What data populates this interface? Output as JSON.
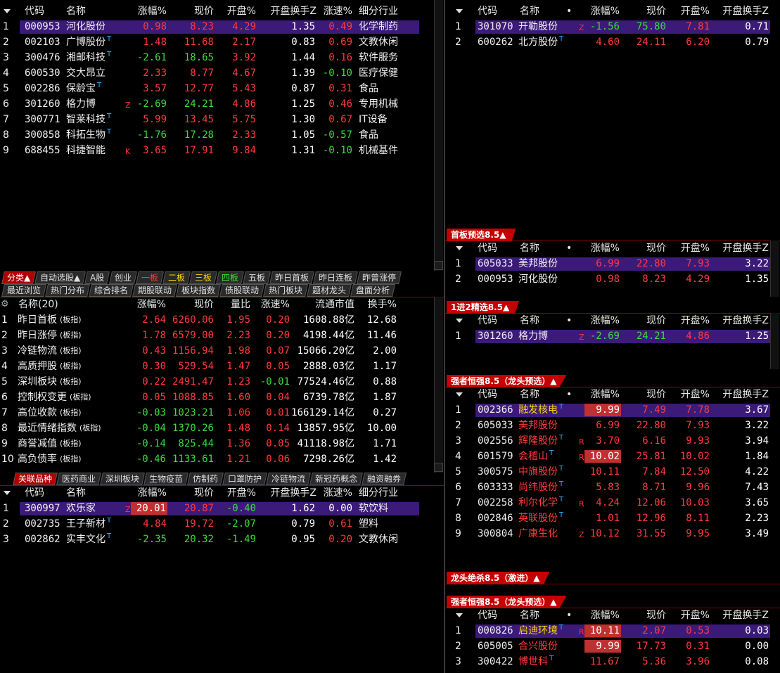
{
  "top_left": {
    "headers": [
      "代码",
      "名称",
      "涨幅%",
      "现价",
      "开盘%",
      "开盘换手Z",
      "涨速%",
      "细分行业"
    ],
    "rows": [
      {
        "i": "1",
        "code": "000953",
        "name": "河化股份",
        "chg": "0.98",
        "price": "8.23",
        "open": "4.29",
        "turn": "1.35",
        "speed": "0.49",
        "ind": "化学制药",
        "tag": "",
        "sup": ""
      },
      {
        "i": "2",
        "code": "002103",
        "name": "广博股份",
        "chg": "1.48",
        "price": "11.68",
        "open": "2.17",
        "turn": "0.83",
        "speed": "0.69",
        "ind": "文教休闲",
        "tag": "",
        "sup": "T"
      },
      {
        "i": "3",
        "code": "300476",
        "name": "湘邮科技",
        "chg": "-2.61",
        "price": "18.65",
        "open": "3.92",
        "turn": "1.44",
        "speed": "0.16",
        "ind": "软件服务",
        "tag": "",
        "sup": "T"
      },
      {
        "i": "4",
        "code": "600530",
        "name": "交大昂立",
        "chg": "2.33",
        "price": "8.77",
        "open": "4.67",
        "turn": "1.39",
        "speed": "-0.10",
        "ind": "医疗保健",
        "tag": "",
        "sup": ""
      },
      {
        "i": "5",
        "code": "002286",
        "name": "保龄宝",
        "chg": "3.57",
        "price": "12.77",
        "open": "5.43",
        "turn": "0.87",
        "speed": "0.31",
        "ind": "食品",
        "tag": "",
        "sup": "T"
      },
      {
        "i": "6",
        "code": "301260",
        "name": "格力博",
        "chg": "-2.69",
        "price": "24.21",
        "open": "4.86",
        "turn": "1.25",
        "speed": "0.46",
        "ind": "专用机械",
        "tag": "Z",
        "sup": ""
      },
      {
        "i": "7",
        "code": "300771",
        "name": "智莱科技",
        "chg": "5.99",
        "price": "13.45",
        "open": "5.75",
        "turn": "1.30",
        "speed": "0.67",
        "ind": "IT设备",
        "tag": "",
        "sup": "T"
      },
      {
        "i": "8",
        "code": "300858",
        "name": "科拓生物",
        "chg": "-1.76",
        "price": "17.28",
        "open": "2.33",
        "turn": "1.05",
        "speed": "-0.57",
        "ind": "食品",
        "tag": "",
        "sup": "T"
      },
      {
        "i": "9",
        "code": "688455",
        "name": "科捷智能",
        "chg": "3.65",
        "price": "17.91",
        "open": "9.84",
        "turn": "1.31",
        "speed": "-0.10",
        "ind": "机械基件",
        "tag": "K",
        "sup": ""
      }
    ]
  },
  "tabs1": [
    "分类▲",
    "自动选股▲",
    "A股",
    "创业",
    "一板",
    "二板",
    "三板",
    "四板",
    "五板",
    "昨日首板",
    "昨日连板",
    "昨曾涨停"
  ],
  "tabs2": [
    "最近浏览",
    "热门分布",
    "综合排名",
    "期股联动",
    "板块指数",
    "债股联动",
    "热门板块",
    "题材龙头",
    "盘面分析"
  ],
  "sector": {
    "headers": [
      "名称(20)",
      "涨幅%",
      "现价",
      "量比",
      "涨速%",
      "流通市值",
      "换手%"
    ],
    "rows": [
      {
        "i": "1",
        "name": "昨日首板",
        "kind": "(板指)",
        "chg": "2.64",
        "price": "6260.06",
        "ratio": "1.95",
        "speed": "0.20",
        "cap": "1608.88亿",
        "turn": "12.68"
      },
      {
        "i": "2",
        "name": "昨日涨停",
        "kind": "(板指)",
        "chg": "1.78",
        "price": "6579.00",
        "ratio": "2.23",
        "speed": "0.20",
        "cap": "4198.44亿",
        "turn": "11.46"
      },
      {
        "i": "3",
        "name": "冷链物流",
        "kind": "(板指)",
        "chg": "0.43",
        "price": "1156.94",
        "ratio": "1.98",
        "speed": "0.07",
        "cap": "15066.20亿",
        "turn": "2.00"
      },
      {
        "i": "4",
        "name": "高质押股",
        "kind": "(板指)",
        "chg": "0.30",
        "price": "529.54",
        "ratio": "1.47",
        "speed": "0.05",
        "cap": "2888.03亿",
        "turn": "1.17"
      },
      {
        "i": "5",
        "name": "深圳板块",
        "kind": "(板指)",
        "chg": "0.22",
        "price": "2491.47",
        "ratio": "1.23",
        "speed": "-0.01",
        "cap": "77524.46亿",
        "turn": "0.88"
      },
      {
        "i": "6",
        "name": "控制权变更",
        "kind": "(板指)",
        "chg": "0.05",
        "price": "1088.85",
        "ratio": "1.60",
        "speed": "0.04",
        "cap": "6739.78亿",
        "turn": "1.87"
      },
      {
        "i": "7",
        "name": "高位收款",
        "kind": "(板指)",
        "chg": "-0.03",
        "price": "1023.21",
        "ratio": "1.06",
        "speed": "0.01",
        "cap": "166129.14亿",
        "turn": "0.27"
      },
      {
        "i": "8",
        "name": "最近情绪指数",
        "kind": "(板指)",
        "chg": "-0.04",
        "price": "1370.26",
        "ratio": "1.48",
        "speed": "0.14",
        "cap": "13857.95亿",
        "turn": "10.00"
      },
      {
        "i": "9",
        "name": "商誉减值",
        "kind": "(板指)",
        "chg": "-0.14",
        "price": "825.44",
        "ratio": "1.36",
        "speed": "0.05",
        "cap": "41118.98亿",
        "turn": "1.71"
      },
      {
        "i": "10",
        "name": "高负债率",
        "kind": "(板指)",
        "chg": "-0.46",
        "price": "1133.61",
        "ratio": "1.21",
        "speed": "0.06",
        "cap": "7298.26亿",
        "turn": "1.42"
      }
    ]
  },
  "tabs3": [
    "关联品种",
    "医药商业",
    "深圳板块",
    "生物疫苗",
    "仿制药",
    "口罩防护",
    "冷链物流",
    "新冠药概念",
    "融资融券"
  ],
  "bottom_left": {
    "headers": [
      "代码",
      "名称",
      "涨幅%",
      "现价",
      "开盘%",
      "开盘换手Z",
      "涨速%",
      "细分行业"
    ],
    "rows": [
      {
        "i": "1",
        "code": "300997",
        "name": "欢乐家",
        "chg": "20.01",
        "price": "20.87",
        "open": "-0.40",
        "turn": "1.62",
        "speed": "0.00",
        "ind": "软饮料",
        "tag": "Z",
        "sup": ""
      },
      {
        "i": "2",
        "code": "002735",
        "name": "王子新材",
        "chg": "4.84",
        "price": "19.72",
        "open": "-2.07",
        "turn": "0.79",
        "speed": "0.61",
        "ind": "塑料",
        "tag": "",
        "sup": "T"
      },
      {
        "i": "3",
        "code": "002862",
        "name": "实丰文化",
        "chg": "-2.35",
        "price": "20.32",
        "open": "-1.49",
        "turn": "0.95",
        "speed": "0.20",
        "ind": "文教休闲",
        "tag": "",
        "sup": "T"
      }
    ]
  },
  "right_headers": [
    "代码",
    "名称",
    "涨幅%",
    "现价",
    "开盘%",
    "开盘换手Z"
  ],
  "right_top": {
    "rows": [
      {
        "i": "1",
        "code": "301070",
        "name": "开勒股份",
        "chg": "-1.56",
        "price": "75.80",
        "open": "7.81",
        "turn": "0.71",
        "tag": "Z",
        "sup": ""
      },
      {
        "i": "2",
        "code": "600262",
        "name": "北方股份",
        "chg": "4.60",
        "price": "24.11",
        "open": "6.20",
        "turn": "0.79",
        "tag": "",
        "sup": "T"
      }
    ]
  },
  "right_panels": [
    {
      "title": "首板预选8.5▲",
      "rows": [
        {
          "i": "1",
          "code": "605033",
          "name": "美邦股份",
          "chg": "6.99",
          "price": "22.80",
          "open": "7.93",
          "turn": "3.22",
          "tag": "",
          "sup": ""
        },
        {
          "i": "2",
          "code": "000953",
          "name": "河化股份",
          "chg": "0.98",
          "price": "8.23",
          "open": "4.29",
          "turn": "1.35",
          "tag": "",
          "sup": ""
        }
      ]
    },
    {
      "title": "1进2精选8.5▲",
      "rows": [
        {
          "i": "1",
          "code": "301260",
          "name": "格力博",
          "chg": "-2.69",
          "price": "24.21",
          "open": "4.86",
          "turn": "1.25",
          "tag": "Z",
          "sup": ""
        }
      ]
    },
    {
      "title": "强者恒强8.5（龙头预选）▲",
      "rows": [
        {
          "i": "1",
          "code": "002366",
          "name": "融发核电",
          "chg": "9.99",
          "price": "7.49",
          "open": "7.78",
          "turn": "3.67",
          "tag": "",
          "sup": "T"
        },
        {
          "i": "2",
          "code": "605033",
          "name": "美邦股份",
          "chg": "6.99",
          "price": "22.80",
          "open": "7.93",
          "turn": "3.22",
          "tag": "",
          "sup": ""
        },
        {
          "i": "3",
          "code": "002556",
          "name": "辉隆股份",
          "chg": "3.70",
          "price": "6.16",
          "open": "9.93",
          "turn": "3.94",
          "tag": "R",
          "sup": "T"
        },
        {
          "i": "4",
          "code": "601579",
          "name": "会稽山",
          "chg": "10.02",
          "price": "25.81",
          "open": "10.02",
          "turn": "1.84",
          "tag": "R",
          "sup": "T"
        },
        {
          "i": "5",
          "code": "300575",
          "name": "中旗股份",
          "chg": "10.11",
          "price": "7.84",
          "open": "12.50",
          "turn": "4.22",
          "tag": "",
          "sup": "T"
        },
        {
          "i": "6",
          "code": "603333",
          "name": "尚纬股份",
          "chg": "5.83",
          "price": "8.71",
          "open": "9.96",
          "turn": "7.43",
          "tag": "",
          "sup": "T"
        },
        {
          "i": "7",
          "code": "002258",
          "name": "利尔化学",
          "chg": "4.24",
          "price": "12.06",
          "open": "10.03",
          "turn": "3.65",
          "tag": "R",
          "sup": "T"
        },
        {
          "i": "8",
          "code": "002846",
          "name": "英联股份",
          "chg": "1.01",
          "price": "12.96",
          "open": "8.11",
          "turn": "2.23",
          "tag": "",
          "sup": "T"
        },
        {
          "i": "9",
          "code": "300804",
          "name": "广康生化",
          "chg": "10.12",
          "price": "31.55",
          "open": "9.95",
          "turn": "3.49",
          "tag": "Z",
          "sup": ""
        }
      ]
    },
    {
      "title": "龙头绝杀8.5（激进）▲",
      "rows": []
    },
    {
      "title": "强者恒强8.5（龙头预选）▲",
      "rows": [
        {
          "i": "1",
          "code": "000826",
          "name": "启迪环境",
          "chg": "10.11",
          "price": "2.07",
          "open": "0.53",
          "turn": "0.03",
          "tag": "R",
          "sup": "T"
        },
        {
          "i": "2",
          "code": "605005",
          "name": "合兴股份",
          "chg": "9.99",
          "price": "17.73",
          "open": "0.31",
          "turn": "0.00",
          "tag": "",
          "sup": ""
        },
        {
          "i": "3",
          "code": "300422",
          "name": "博世科",
          "chg": "11.67",
          "price": "5.36",
          "open": "3.96",
          "turn": "0.08",
          "tag": "",
          "sup": "T"
        }
      ]
    }
  ]
}
